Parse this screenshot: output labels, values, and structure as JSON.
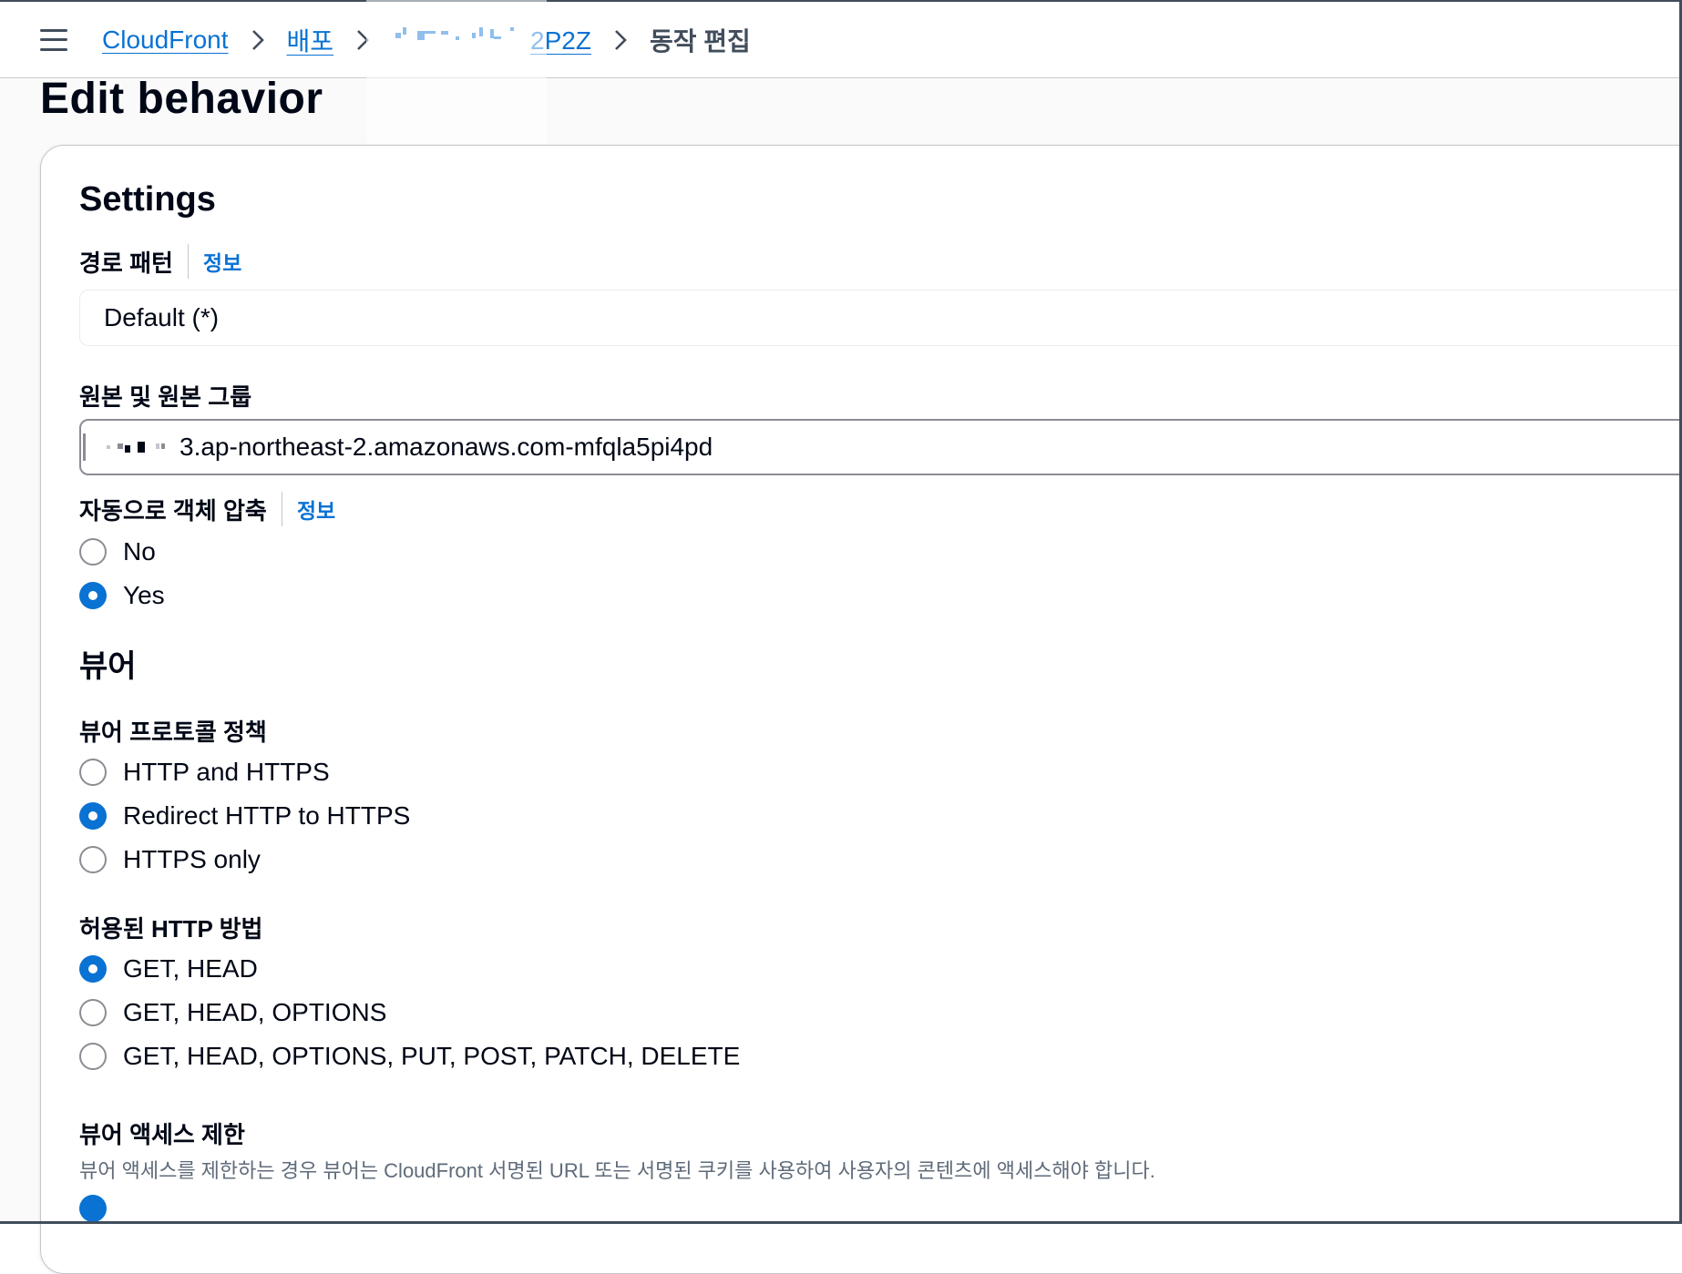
{
  "breadcrumb": {
    "items": [
      {
        "label": "CloudFront"
      },
      {
        "label": "배포"
      },
      {
        "label": "2P2Z"
      },
      {
        "label": "동작 편집"
      }
    ]
  },
  "page": {
    "title": "Edit behavior"
  },
  "settings": {
    "title": "Settings",
    "path_pattern": {
      "label": "경로 패턴",
      "info": "정보",
      "value": "Default (*)"
    },
    "origin": {
      "label": "원본 및 원본 그룹",
      "value": "3.ap-northeast-2.amazonaws.com-mfqla5pi4pd"
    },
    "compress": {
      "label": "자동으로 객체 압축",
      "info": "정보",
      "options": [
        {
          "label": "No",
          "checked": false
        },
        {
          "label": "Yes",
          "checked": true
        }
      ]
    }
  },
  "viewer": {
    "heading": "뷰어",
    "protocol_policy": {
      "label": "뷰어 프로토콜 정책",
      "options": [
        {
          "label": "HTTP and HTTPS",
          "checked": false
        },
        {
          "label": "Redirect HTTP to HTTPS",
          "checked": true
        },
        {
          "label": "HTTPS only",
          "checked": false
        }
      ]
    },
    "allowed_methods": {
      "label": "허용된 HTTP 방법",
      "options": [
        {
          "label": "GET, HEAD",
          "checked": true
        },
        {
          "label": "GET, HEAD, OPTIONS",
          "checked": false
        },
        {
          "label": "GET, HEAD, OPTIONS, PUT, POST, PATCH, DELETE",
          "checked": false
        }
      ]
    },
    "restrict_access": {
      "label": "뷰어 액세스 제한",
      "description": "뷰어 액세스를 제한하는 경우 뷰어는 CloudFront 서명된 URL 또는 서명된 쿠키를 사용하여 사용자의 콘텐츠에 액세스해야 합니다."
    }
  },
  "colors": {
    "link": "#0972d3",
    "radio_checked": "#0972d3",
    "text": "#000716"
  }
}
